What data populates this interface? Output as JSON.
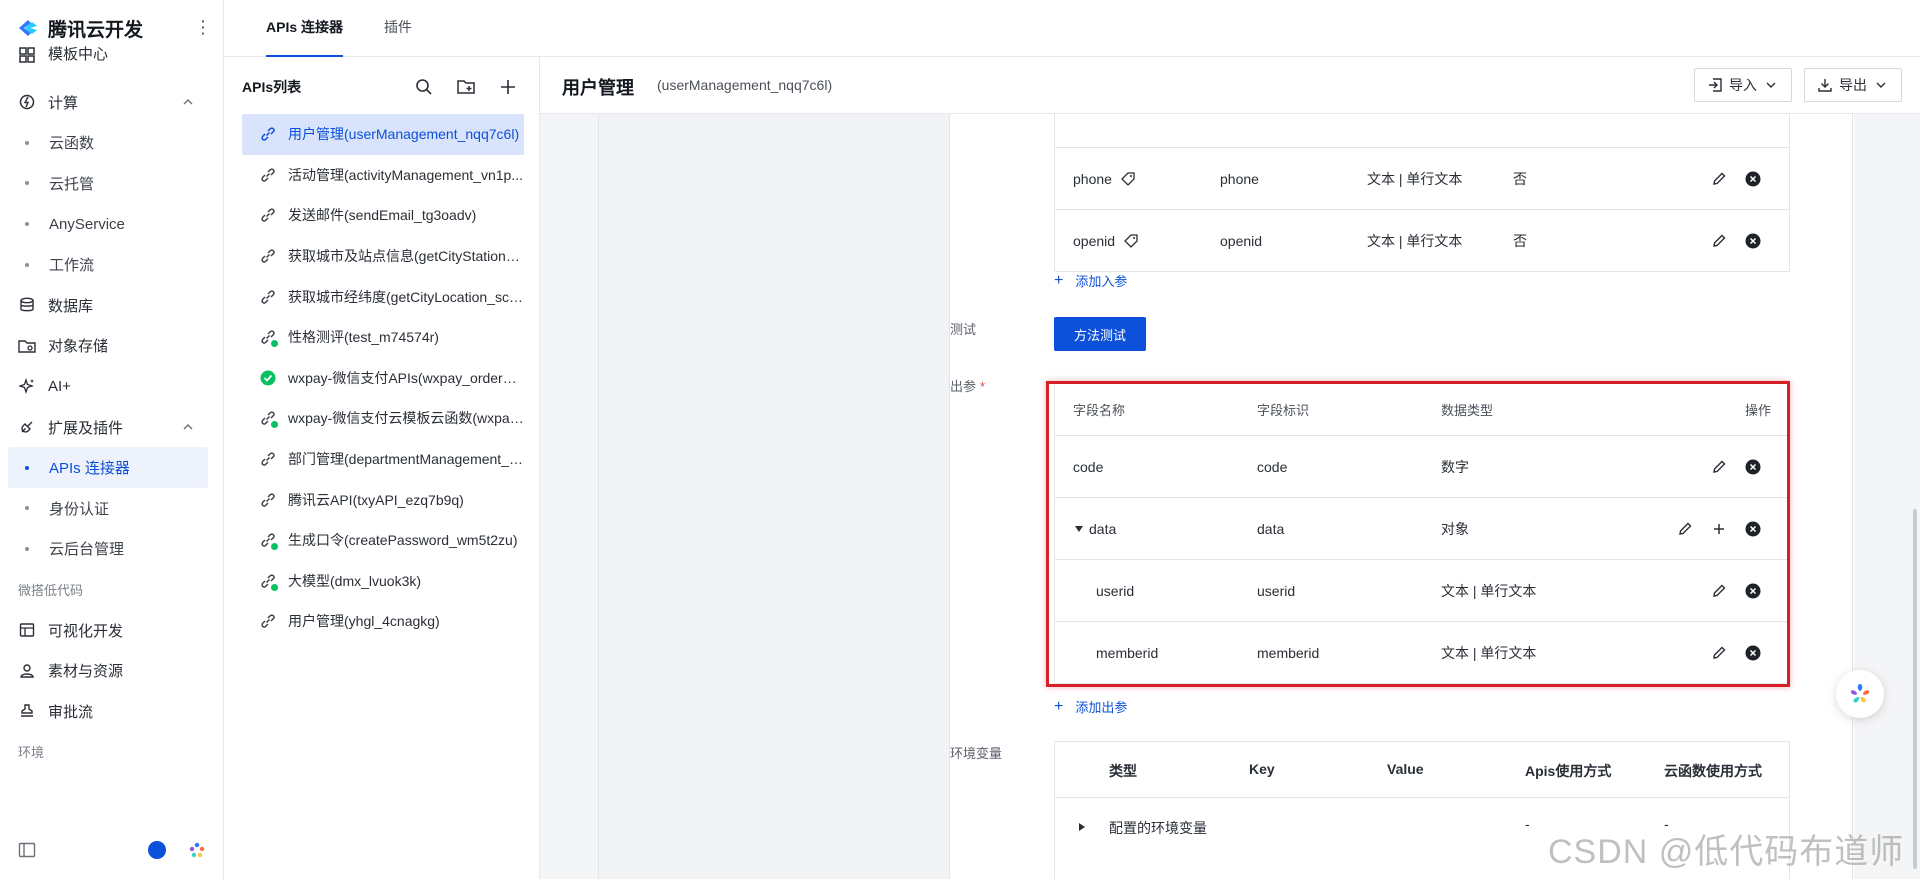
{
  "brand": {
    "name": "腾讯云开发"
  },
  "nav": {
    "partial_item": "模板中心",
    "items": [
      {
        "label": "计算",
        "type": "section",
        "icon": "compute-icon",
        "expanded": true
      },
      {
        "label": "云函数",
        "type": "sub"
      },
      {
        "label": "云托管",
        "type": "sub"
      },
      {
        "label": "AnyService",
        "type": "sub"
      },
      {
        "label": "工作流",
        "type": "sub"
      },
      {
        "label": "数据库",
        "type": "section",
        "icon": "database-icon"
      },
      {
        "label": "对象存储",
        "type": "section",
        "icon": "storage-icon"
      },
      {
        "label": "AI+",
        "type": "section",
        "icon": "ai-sparkle-icon"
      },
      {
        "label": "扩展及插件",
        "type": "section",
        "icon": "plugin-icon",
        "expanded": true
      },
      {
        "label": "APIs 连接器",
        "type": "sub",
        "active": true
      },
      {
        "label": "身份认证",
        "type": "sub"
      },
      {
        "label": "云后台管理",
        "type": "sub"
      },
      {
        "label": "微搭低代码",
        "type": "group"
      },
      {
        "label": "可视化开发",
        "type": "section",
        "icon": "visual-dev-icon"
      },
      {
        "label": "素材与资源",
        "type": "section",
        "icon": "assets-icon"
      },
      {
        "label": "审批流",
        "type": "section",
        "icon": "approval-icon"
      },
      {
        "label": "环境",
        "type": "group"
      }
    ]
  },
  "tabs": [
    {
      "label": "APIs 连接器",
      "active": true
    },
    {
      "label": "插件",
      "active": false
    }
  ],
  "apis": {
    "title": "APIs列表",
    "items": [
      {
        "label": "用户管理(userManagement_nqq7c6l)",
        "active": true,
        "icon": "link-icon"
      },
      {
        "label": "活动管理(activityManagement_vn1p...",
        "icon": "link-icon"
      },
      {
        "label": "发送邮件(sendEmail_tg3oadv)",
        "icon": "link-icon"
      },
      {
        "label": "获取城市及站点信息(getCityStation_...",
        "icon": "link-icon"
      },
      {
        "label": "获取城市经纬度(getCityLocation_sca...",
        "icon": "link-icon"
      },
      {
        "label": "性格测评(test_m74574r)",
        "icon": "link-icon",
        "badge": true
      },
      {
        "label": "wxpay-微信支付APIs(wxpay_order_a...",
        "icon": "wechat-pay-icon"
      },
      {
        "label": "wxpay-微信支付云模板云函数(wxpay...",
        "icon": "link-icon",
        "badge": true
      },
      {
        "label": "部门管理(departmentManagement_a...",
        "icon": "link-icon"
      },
      {
        "label": "腾讯云API(txyAPI_ezq7b9q)",
        "icon": "link-icon"
      },
      {
        "label": "生成口令(createPassword_wm5t2zu)",
        "icon": "link-icon",
        "badge": true
      },
      {
        "label": "大模型(dmx_lvuok3k)",
        "icon": "link-icon",
        "badge": true
      },
      {
        "label": "用户管理(yhgl_4cnagkg)",
        "icon": "link-icon"
      }
    ]
  },
  "main": {
    "title": "用户管理",
    "subtitle": "(userManagement_nqq7c6l)",
    "import_label": "导入",
    "export_label": "导出"
  },
  "input_params": {
    "rows": [
      {
        "name": "phone",
        "id": "phone",
        "type": "文本 | 单行文本",
        "required": "否"
      },
      {
        "name": "openid",
        "id": "openid",
        "type": "文本 | 单行文本",
        "required": "否"
      }
    ],
    "add_label": "添加入参"
  },
  "test": {
    "label": "测试",
    "button": "方法测试"
  },
  "output_params": {
    "label": "出参",
    "required_mark": "*",
    "headers": {
      "name": "字段名称",
      "id": "字段标识",
      "type": "数据类型",
      "ops": "操作"
    },
    "rows": [
      {
        "name": "code",
        "id": "code",
        "type": "数字",
        "level": 0
      },
      {
        "name": "data",
        "id": "data",
        "type": "对象",
        "level": 0,
        "expandable": true
      },
      {
        "name": "userid",
        "id": "userid",
        "type": "文本 | 单行文本",
        "level": 1
      },
      {
        "name": "memberid",
        "id": "memberid",
        "type": "文本 | 单行文本",
        "level": 1
      }
    ],
    "add_label": "添加出参"
  },
  "env_vars": {
    "label": "环境变量",
    "headers": {
      "type": "类型",
      "key": "Key",
      "value": "Value",
      "apis_usage": "Apis使用方式",
      "fn_usage": "云函数使用方式"
    },
    "row": {
      "label": "配置的环境变量",
      "apis_usage": "-",
      "fn_usage": "-"
    }
  },
  "watermark": "CSDN @低代码布道师",
  "colors": {
    "primary": "#0d50d9",
    "highlight": "#d61f26",
    "active_bg": "#d9e3fb"
  }
}
